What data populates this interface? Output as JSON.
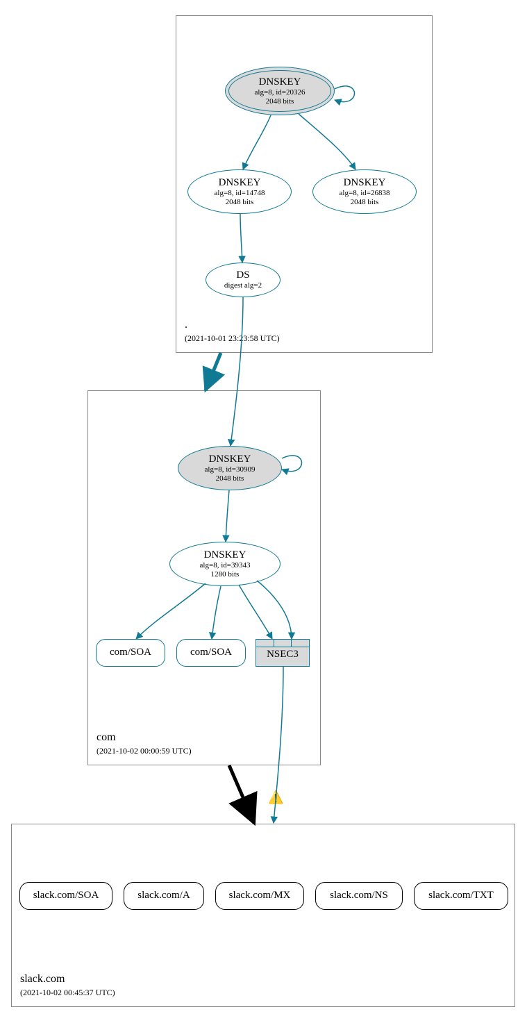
{
  "zones": {
    "root": {
      "name": ".",
      "ts": "(2021-10-01 23:23:58 UTC)"
    },
    "com": {
      "name": "com",
      "ts": "(2021-10-02 00:00:59 UTC)"
    },
    "slack": {
      "name": "slack.com",
      "ts": "(2021-10-02 00:45:37 UTC)"
    }
  },
  "nodes": {
    "root_ksk": {
      "title": "DNSKEY",
      "l1": "alg=8, id=20326",
      "l2": "2048 bits"
    },
    "root_zsk1": {
      "title": "DNSKEY",
      "l1": "alg=8, id=14748",
      "l2": "2048 bits"
    },
    "root_zsk2": {
      "title": "DNSKEY",
      "l1": "alg=8, id=26838",
      "l2": "2048 bits"
    },
    "root_ds": {
      "title": "DS",
      "l1": "digest alg=2"
    },
    "com_ksk": {
      "title": "DNSKEY",
      "l1": "alg=8, id=30909",
      "l2": "2048 bits"
    },
    "com_zsk": {
      "title": "DNSKEY",
      "l1": "alg=8, id=39343",
      "l2": "1280 bits"
    },
    "com_soa1": {
      "label": "com/SOA"
    },
    "com_soa2": {
      "label": "com/SOA"
    },
    "nsec3": {
      "label": "NSEC3"
    },
    "slack_soa": {
      "label": "slack.com/SOA"
    },
    "slack_a": {
      "label": "slack.com/A"
    },
    "slack_mx": {
      "label": "slack.com/MX"
    },
    "slack_ns": {
      "label": "slack.com/NS"
    },
    "slack_txt": {
      "label": "slack.com/TXT"
    }
  },
  "colors": {
    "teal": "#107a94",
    "grey": "#d9d9d9",
    "black": "#000000"
  }
}
